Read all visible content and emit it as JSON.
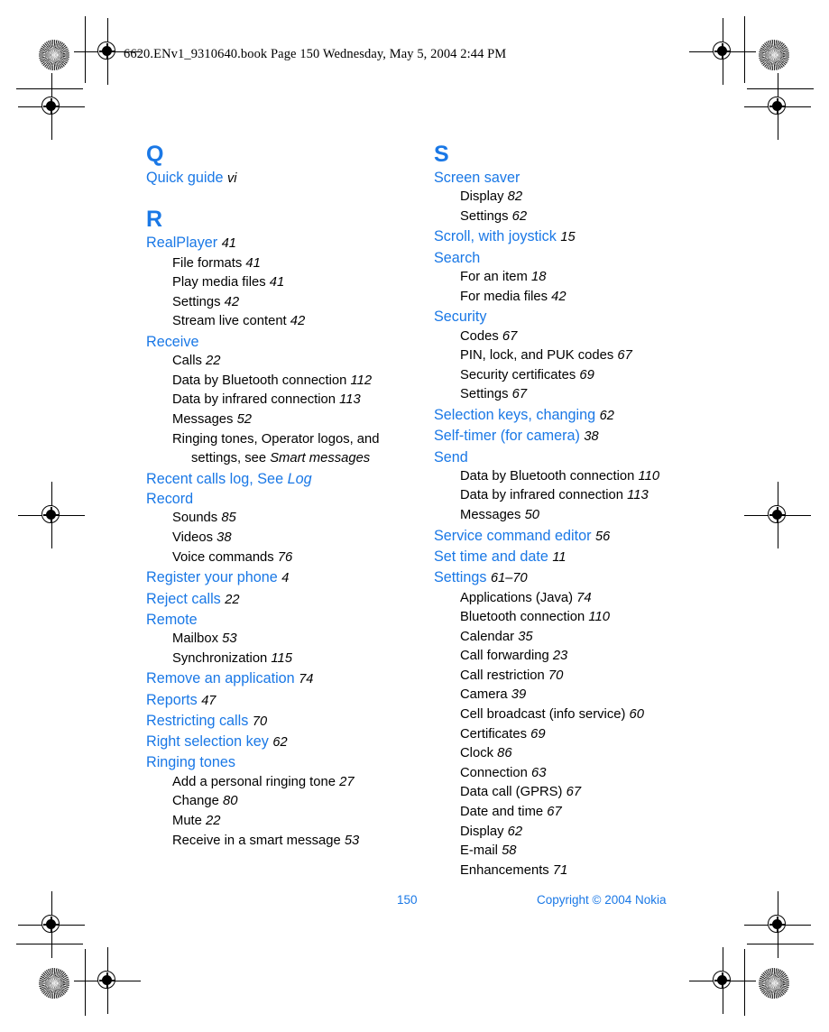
{
  "page": {
    "header_text": "6620.ENv1_9310640.book  Page 150  Wednesday, May 5, 2004  2:44 PM",
    "accent_color": "#1a78e6",
    "text_color": "#000000",
    "background_color": "#ffffff"
  },
  "footer": {
    "page_number": "150",
    "copyright": "Copyright © 2004 Nokia"
  },
  "index": {
    "left_column": [
      {
        "type": "letter",
        "label": "Q"
      },
      {
        "type": "entry",
        "label": "Quick guide",
        "page": "vi",
        "page_italic_blue": true
      },
      {
        "type": "letter",
        "label": "R",
        "spaced": true
      },
      {
        "type": "entry",
        "label": "RealPlayer",
        "page": "41"
      },
      {
        "type": "sub",
        "label": "File formats",
        "page": "41"
      },
      {
        "type": "sub",
        "label": "Play media files",
        "page": "41"
      },
      {
        "type": "sub",
        "label": "Settings",
        "page": "42"
      },
      {
        "type": "sub",
        "label": "Stream live content",
        "page": "42"
      },
      {
        "type": "entry",
        "label": "Receive",
        "page": ""
      },
      {
        "type": "sub",
        "label": "Calls",
        "page": "22"
      },
      {
        "type": "sub",
        "label": "Data by Bluetooth connection",
        "page": "112"
      },
      {
        "type": "sub",
        "label": "Data by infrared connection",
        "page": "113"
      },
      {
        "type": "sub",
        "label": "Messages",
        "page": "52"
      },
      {
        "type": "sub-wrap",
        "label": "Ringing tones, Operator logos, and settings, see ",
        "italic_tail": "Smart messages",
        "page": ""
      },
      {
        "type": "entry",
        "label": "Recent calls log, See ",
        "italic_tail": "Log",
        "page": ""
      },
      {
        "type": "entry",
        "label": "Record",
        "page": ""
      },
      {
        "type": "sub",
        "label": "Sounds",
        "page": "85"
      },
      {
        "type": "sub",
        "label": "Videos",
        "page": "38"
      },
      {
        "type": "sub",
        "label": "Voice commands",
        "page": "76"
      },
      {
        "type": "entry",
        "label": "Register your phone",
        "page": "4"
      },
      {
        "type": "entry",
        "label": "Reject calls",
        "page": "22"
      },
      {
        "type": "entry",
        "label": "Remote",
        "page": ""
      },
      {
        "type": "sub",
        "label": "Mailbox",
        "page": "53"
      },
      {
        "type": "sub",
        "label": "Synchronization",
        "page": "115"
      },
      {
        "type": "entry",
        "label": "Remove an application",
        "page": "74"
      },
      {
        "type": "entry",
        "label": "Reports",
        "page": "47"
      },
      {
        "type": "entry",
        "label": "Restricting calls",
        "page": "70"
      },
      {
        "type": "entry",
        "label": "Right selection key",
        "page": "62"
      },
      {
        "type": "entry",
        "label": "Ringing tones",
        "page": ""
      },
      {
        "type": "sub",
        "label": "Add a personal ringing tone",
        "page": "27"
      },
      {
        "type": "sub",
        "label": "Change",
        "page": "80"
      },
      {
        "type": "sub",
        "label": "Mute",
        "page": "22"
      },
      {
        "type": "sub",
        "label": "Receive in a smart message",
        "page": "53"
      }
    ],
    "right_column": [
      {
        "type": "letter",
        "label": "S"
      },
      {
        "type": "entry",
        "label": "Screen saver",
        "page": ""
      },
      {
        "type": "sub",
        "label": "Display",
        "page": "82"
      },
      {
        "type": "sub",
        "label": "Settings",
        "page": "62"
      },
      {
        "type": "entry",
        "label": "Scroll, with joystick",
        "page": "15"
      },
      {
        "type": "entry",
        "label": "Search",
        "page": ""
      },
      {
        "type": "sub",
        "label": "For an item",
        "page": "18"
      },
      {
        "type": "sub",
        "label": "For media files",
        "page": "42"
      },
      {
        "type": "entry",
        "label": "Security",
        "page": ""
      },
      {
        "type": "sub",
        "label": "Codes",
        "page": "67"
      },
      {
        "type": "sub",
        "label": "PIN, lock, and PUK codes",
        "page": "67"
      },
      {
        "type": "sub",
        "label": "Security certificates",
        "page": "69"
      },
      {
        "type": "sub",
        "label": "Settings",
        "page": "67"
      },
      {
        "type": "entry",
        "label": "Selection keys, changing",
        "page": "62"
      },
      {
        "type": "entry",
        "label": "Self-timer (for camera)",
        "page": "38"
      },
      {
        "type": "entry",
        "label": "Send",
        "page": ""
      },
      {
        "type": "sub",
        "label": "Data by Bluetooth connection",
        "page": "110"
      },
      {
        "type": "sub",
        "label": "Data by infrared connection",
        "page": "113"
      },
      {
        "type": "sub",
        "label": "Messages",
        "page": "50"
      },
      {
        "type": "entry",
        "label": "Service command editor",
        "page": "56"
      },
      {
        "type": "entry",
        "label": "Set time and date",
        "page": "11"
      },
      {
        "type": "entry",
        "label": "Settings",
        "page": "61–70"
      },
      {
        "type": "sub",
        "label": "Applications (Java)",
        "page": "74"
      },
      {
        "type": "sub",
        "label": "Bluetooth connection",
        "page": "110"
      },
      {
        "type": "sub",
        "label": "Calendar",
        "page": "35"
      },
      {
        "type": "sub",
        "label": "Call forwarding",
        "page": "23"
      },
      {
        "type": "sub",
        "label": "Call restriction",
        "page": "70"
      },
      {
        "type": "sub",
        "label": "Camera",
        "page": "39"
      },
      {
        "type": "sub",
        "label": "Cell broadcast (info service)",
        "page": "60"
      },
      {
        "type": "sub",
        "label": "Certificates",
        "page": "69"
      },
      {
        "type": "sub",
        "label": "Clock",
        "page": "86"
      },
      {
        "type": "sub",
        "label": "Connection",
        "page": "63"
      },
      {
        "type": "sub",
        "label": "Data call (GPRS)",
        "page": "67"
      },
      {
        "type": "sub",
        "label": "Date and time",
        "page": "67"
      },
      {
        "type": "sub",
        "label": "Display",
        "page": "62"
      },
      {
        "type": "sub",
        "label": "E-mail",
        "page": "58"
      },
      {
        "type": "sub",
        "label": "Enhancements",
        "page": "71"
      }
    ]
  }
}
